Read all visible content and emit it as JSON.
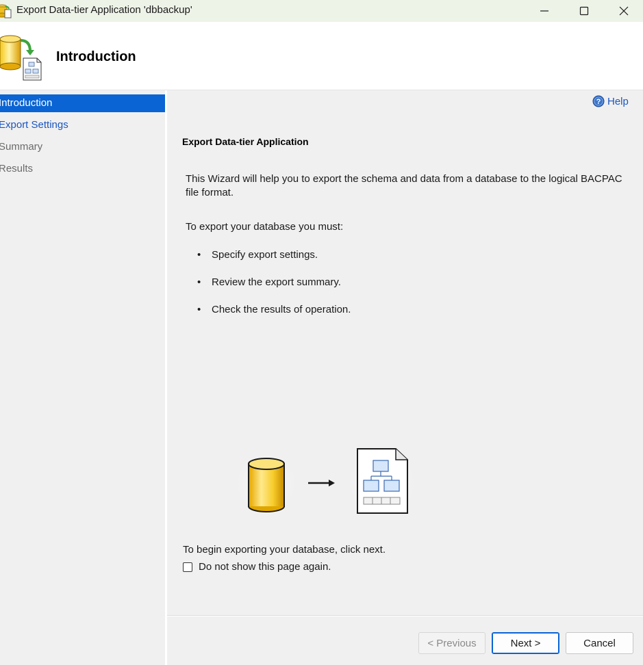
{
  "window": {
    "title": "Export Data-tier Application 'dbbackup'",
    "controls": [
      "minimize-icon",
      "maximize-icon",
      "close-icon"
    ]
  },
  "header": {
    "title": "Introduction",
    "icon": "database-export-icon"
  },
  "nav": {
    "items": [
      {
        "label": "Introduction",
        "state": "selected"
      },
      {
        "label": "Export Settings",
        "state": "link"
      },
      {
        "label": "Summary",
        "state": "disabled"
      },
      {
        "label": "Results",
        "state": "disabled"
      }
    ]
  },
  "content": {
    "help_label": "Help",
    "section_title": "Export Data-tier Application",
    "description": "This Wizard will help you to export the schema and data from a database to the logical BACPAC file format.",
    "must_label": "To export your database you must:",
    "bullets": [
      "Specify export settings.",
      "Review the export summary.",
      "Check the results of operation."
    ],
    "begin_text": "To begin exporting your database, click next.",
    "checkbox_label": "Do not show this page again.",
    "checkbox_checked": false
  },
  "footer": {
    "previous_label": "< Previous",
    "next_label": "Next >",
    "cancel_label": "Cancel"
  },
  "colors": {
    "selected_nav": "#0a64d3",
    "link": "#1a56c0",
    "title_bar": "#eef3e8"
  }
}
